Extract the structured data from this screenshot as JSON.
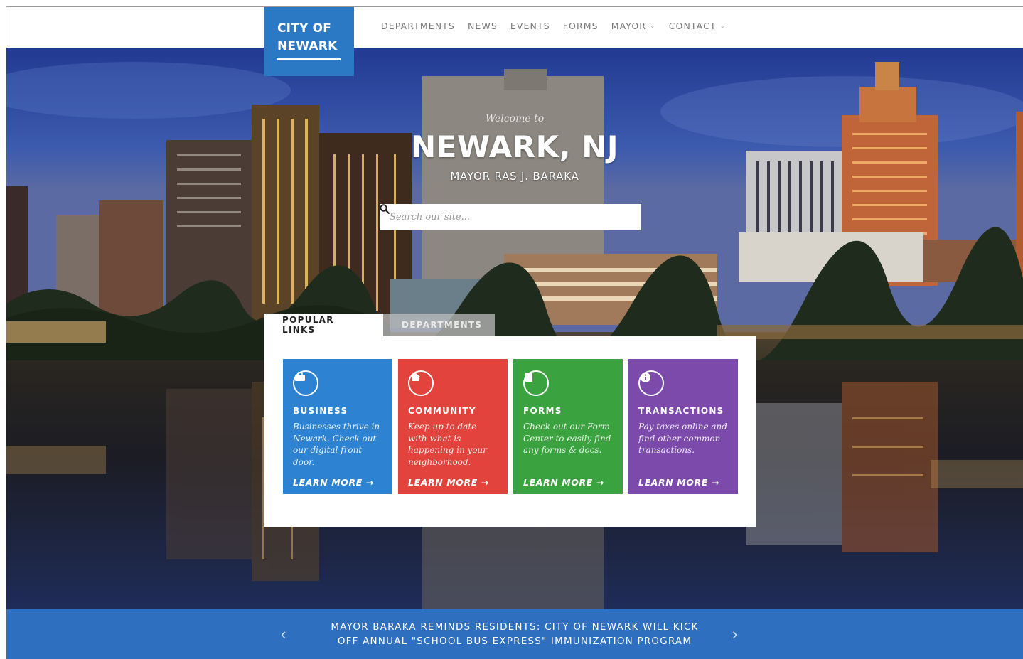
{
  "header": {
    "logo_line1": "CITY OF",
    "logo_line2": "NEWARK",
    "nav": [
      {
        "label": "DEPARTMENTS"
      },
      {
        "label": "NEWS"
      },
      {
        "label": "EVENTS"
      },
      {
        "label": "FORMS"
      },
      {
        "label": "MAYOR"
      },
      {
        "label": "CONTACT"
      }
    ]
  },
  "hero": {
    "welcome": "Welcome to",
    "title": "NEWARK, NJ",
    "subtitle": "MAYOR RAS J. BARAKA",
    "search_placeholder": "Search our site..."
  },
  "links_panel": {
    "tabs": [
      {
        "label": "POPULAR LINKS",
        "active": true
      },
      {
        "label": "DEPARTMENTS",
        "active": false
      }
    ],
    "cards": [
      {
        "title": "BUSINESS",
        "description": "Businesses thrive in Newark. Check out our digital front door.",
        "cta": "LEARN MORE →",
        "icon": "briefcase-icon",
        "color": "#2d83d2"
      },
      {
        "title": "COMMUNITY",
        "description": "Keep up to date with what is happening in your neighborhood.",
        "cta": "LEARN MORE →",
        "icon": "home-icon",
        "color": "#e2433c"
      },
      {
        "title": "FORMS",
        "description": "Check out our Form Center to easily find any forms & docs.",
        "cta": "LEARN MORE →",
        "icon": "document-icon",
        "color": "#3aa23f"
      },
      {
        "title": "TRANSACTIONS",
        "description": "Pay taxes online and find other common transactions.",
        "cta": "LEARN MORE →",
        "icon": "info-icon",
        "color": "#7b4aab"
      }
    ]
  },
  "banner": {
    "line1": "MAYOR BARAKA REMINDS RESIDENTS: CITY OF NEWARK WILL KICK",
    "line2": "OFF ANNUAL \"SCHOOL BUS EXPRESS\" IMMUNIZATION PROGRAM",
    "prev": "‹",
    "next": "›"
  },
  "colors": {
    "brand_blue": "#2b78c5",
    "banner_blue": "#2e6fc0"
  }
}
